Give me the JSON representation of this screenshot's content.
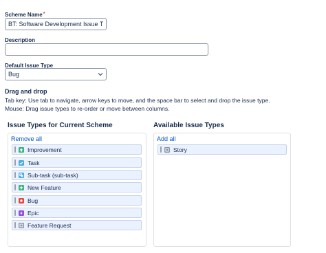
{
  "form": {
    "scheme_name_label": "Scheme Name",
    "required_marker": "*",
    "scheme_name_value": "BT: Software Development Issue Typ",
    "description_label": "Description",
    "description_value": "",
    "default_issue_type_label": "Default Issue Type",
    "default_issue_type_value": "Bug"
  },
  "drag_drop": {
    "title": "Drag and drop",
    "help_line1": "Tab key: Use tab to navigate, arrow keys to move, and the space bar to select and drop the issue type.",
    "help_line2": "Mouse: Drag issue types to re-order or move between columns."
  },
  "current_scheme": {
    "title": "Issue Types for Current Scheme",
    "action_label": "Remove all",
    "items": [
      {
        "label": "Improvement",
        "icon": "improvement-icon",
        "color": "#36b37e"
      },
      {
        "label": "Task",
        "icon": "task-icon",
        "color": "#4bade8"
      },
      {
        "label": "Sub-task (sub-task)",
        "icon": "subtask-icon",
        "color": "#4bade8"
      },
      {
        "label": "New Feature",
        "icon": "new-feature-icon",
        "color": "#36b37e"
      },
      {
        "label": "Bug",
        "icon": "bug-icon",
        "color": "#e5493a"
      },
      {
        "label": "Epic",
        "icon": "epic-icon",
        "color": "#904ee2"
      },
      {
        "label": "Feature Request",
        "icon": "feature-request-icon",
        "color": "#8993a4"
      }
    ]
  },
  "available": {
    "title": "Available Issue Types",
    "action_label": "Add all",
    "items": [
      {
        "label": "Story",
        "icon": "story-icon",
        "color": "#8993a4"
      }
    ]
  },
  "colors": {
    "link": "#0052cc",
    "item_background": "#ebf2ff",
    "text": "#172b4d"
  }
}
